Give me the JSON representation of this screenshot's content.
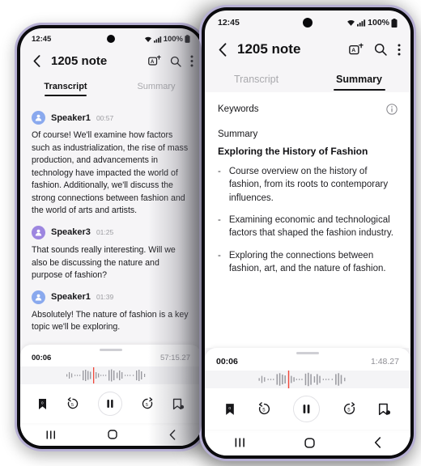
{
  "phones": {
    "left": {
      "status": {
        "time": "12:45",
        "battery": "100%",
        "wifi_icon": "wifi-icon",
        "signal_icon": "signal-icon",
        "battery_icon": "battery-icon"
      },
      "appbar": {
        "back_icon": "back-arrow-icon",
        "title": "1205 note",
        "translate_icon": "translate-icon",
        "search_icon": "search-icon",
        "more_icon": "more-vertical-icon"
      },
      "tabs": [
        {
          "label": "Transcript",
          "active": true
        },
        {
          "label": "Summary",
          "active": false
        }
      ],
      "transcript": [
        {
          "speaker": "Speaker1",
          "time": "00:57",
          "avatar_color": "#8aa9ee",
          "text": "Of course! We'll examine how factors such as industrialization, the rise of mass production, and advancements in technology have impacted the world of fashion. Additionally, we'll discuss the strong connections between fashion and the world of arts and artists."
        },
        {
          "speaker": "Speaker3",
          "time": "01:25",
          "avatar_color": "#9d86e0",
          "text": "That sounds really interesting. Will we also be discussing the nature and purpose of fashion?"
        },
        {
          "speaker": "Speaker1",
          "time": "01:39",
          "avatar_color": "#8aa9ee",
          "text": "Absolutely! The nature of fashion is a key topic we'll be exploring."
        }
      ],
      "player": {
        "current_time": "00:06",
        "total_time": "57:15.27",
        "playhead_color": "#f0473a",
        "bookmark_icon": "bookmark-icon",
        "rewind_icon": "rewind-5-icon",
        "play_icon": "pause-icon",
        "forward_icon": "forward-5-icon",
        "add_bookmark_icon": "add-bookmark-icon"
      },
      "navbar": {
        "recents_icon": "recents-icon",
        "home_icon": "home-icon",
        "back_icon": "back-nav-icon"
      }
    },
    "right": {
      "status": {
        "time": "12:45",
        "battery": "100%",
        "wifi_icon": "wifi-icon",
        "signal_icon": "signal-icon",
        "battery_icon": "battery-icon"
      },
      "appbar": {
        "back_icon": "back-arrow-icon",
        "title": "1205 note",
        "translate_icon": "translate-icon",
        "search_icon": "search-icon",
        "more_icon": "more-vertical-icon"
      },
      "tabs": [
        {
          "label": "Transcript",
          "active": false
        },
        {
          "label": "Summary",
          "active": true
        }
      ],
      "summary": {
        "keywords_label": "Keywords",
        "info_icon": "info-icon",
        "summary_label": "Summary",
        "heading": "Exploring the History of Fashion",
        "bullet_marker": "-",
        "bullets": [
          "Course overview on the history of fashion, from its roots to contemporary influences.",
          "Examining economic and technological factors that shaped the fashion industry.",
          "Exploring the connections between fashion, art, and the nature of fashion."
        ]
      },
      "player": {
        "current_time": "00:06",
        "total_time": "1:48.27",
        "playhead_color": "#f0473a",
        "bookmark_icon": "bookmark-icon",
        "rewind_icon": "rewind-5-icon",
        "play_icon": "pause-icon",
        "forward_icon": "forward-5-icon",
        "add_bookmark_icon": "add-bookmark-icon"
      },
      "navbar": {
        "recents_icon": "recents-icon",
        "home_icon": "home-icon",
        "back_icon": "back-nav-icon"
      }
    }
  },
  "theme": {
    "frame_color": "#b7b0d4",
    "bezel_color": "#0b0b0e",
    "screen_bg": "#f6f5f7",
    "accent_red": "#f0473a"
  }
}
